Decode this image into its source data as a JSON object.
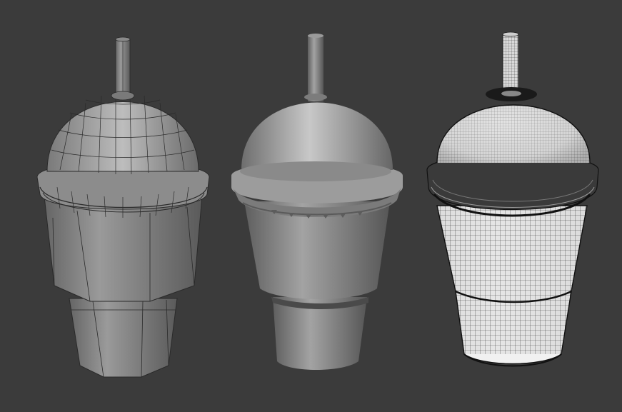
{
  "scene": {
    "background": "#3b3b3b",
    "models": [
      {
        "name": "low-poly-cup",
        "shading": "flat-wireframe",
        "color": "#8e8e8e"
      },
      {
        "name": "smooth-shaded-cup",
        "shading": "smooth",
        "color": "#9a9a9a"
      },
      {
        "name": "subdivided-wireframe-cup",
        "shading": "dense-wireframe",
        "color": "#e9e9e9"
      }
    ]
  }
}
